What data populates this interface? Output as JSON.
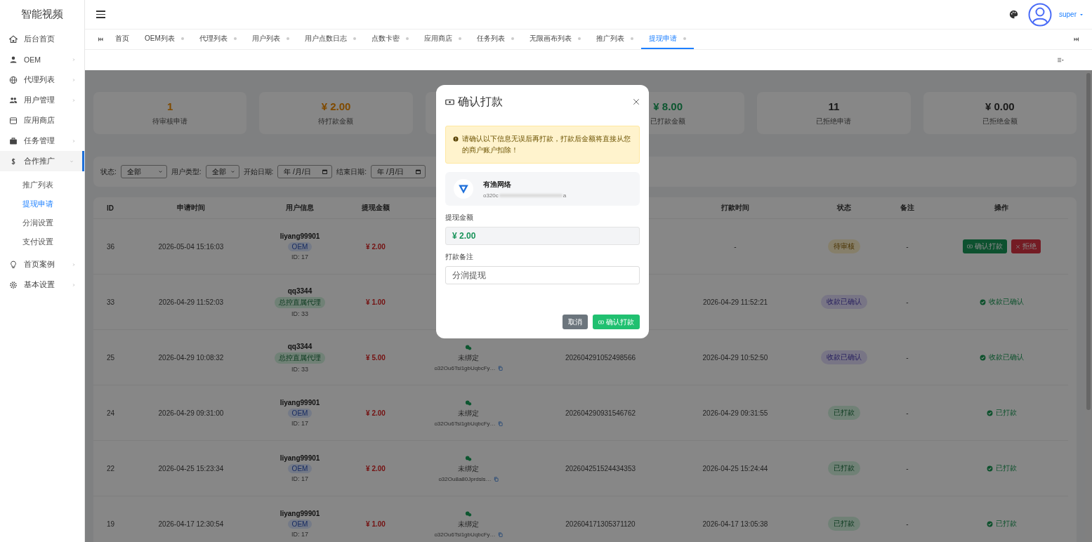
{
  "brand": "智能视频",
  "header": {
    "user": "super"
  },
  "sidebar": {
    "items": [
      {
        "label": "后台首页",
        "expandable": false,
        "expanded": false
      },
      {
        "label": "OEM",
        "expandable": true,
        "expanded": false
      },
      {
        "label": "代理列表",
        "expandable": true,
        "expanded": false
      },
      {
        "label": "用户管理",
        "expandable": true,
        "expanded": false
      },
      {
        "label": "应用商店",
        "expandable": false,
        "expanded": false
      },
      {
        "label": "任务管理",
        "expandable": true,
        "expanded": false
      },
      {
        "label": "合作推广",
        "expandable": true,
        "expanded": true,
        "children": [
          {
            "label": "推广列表",
            "selected": false
          },
          {
            "label": "提现申请",
            "selected": true
          },
          {
            "label": "分润设置",
            "selected": false
          },
          {
            "label": "支付设置",
            "selected": false
          }
        ]
      },
      {
        "label": "首页案例",
        "expandable": true,
        "expanded": false
      },
      {
        "label": "基本设置",
        "expandable": true,
        "expanded": false
      }
    ]
  },
  "tabs": [
    {
      "label": "首页",
      "closable": false,
      "selected": false
    },
    {
      "label": "OEM列表",
      "closable": true,
      "selected": false
    },
    {
      "label": "代理列表",
      "closable": true,
      "selected": false
    },
    {
      "label": "用户列表",
      "closable": true,
      "selected": false
    },
    {
      "label": "用户点数日志",
      "closable": true,
      "selected": false
    },
    {
      "label": "点数卡密",
      "closable": true,
      "selected": false
    },
    {
      "label": "应用商店",
      "closable": true,
      "selected": false
    },
    {
      "label": "任务列表",
      "closable": true,
      "selected": false
    },
    {
      "label": "无限画布列表",
      "closable": true,
      "selected": false
    },
    {
      "label": "推广列表",
      "closable": true,
      "selected": false
    },
    {
      "label": "提现申请",
      "closable": true,
      "selected": true
    }
  ],
  "stats": [
    {
      "kind": "warning",
      "value": "1",
      "label": "待审核申请"
    },
    {
      "kind": "warning",
      "value": "¥ 2.00",
      "label": "待打款金额"
    },
    {
      "kind": "covered"
    },
    {
      "kind": "success",
      "value": "¥ 8.00",
      "label": "已打款金额"
    },
    {
      "kind": "neutral",
      "value": "11",
      "label": "已拒绝申请"
    },
    {
      "kind": "neutral",
      "value": "¥ 0.00",
      "label": "已拒绝金额"
    }
  ],
  "filters": [
    {
      "label": "状态:",
      "kind": "select",
      "value": "全部"
    },
    {
      "label": "用户类型:",
      "kind": "select",
      "value": "全部"
    },
    {
      "label": "开始日期:",
      "kind": "date",
      "value": "年 /月/日"
    },
    {
      "label": "结束日期:",
      "kind": "date",
      "value": "年 /月/日"
    }
  ],
  "table": {
    "columns": [
      {
        "label": "ID"
      },
      {
        "label": "申请时间"
      },
      {
        "label": "用户信息"
      },
      {
        "label": "提现金额"
      },
      {},
      {},
      {
        "label": "打款时间"
      },
      {
        "label": "状态"
      },
      {
        "label": "备注"
      },
      {
        "label": "操作"
      }
    ],
    "rows": [
      {
        "id": "36",
        "apply_time": "2026-05-04 15:16:03",
        "user": {
          "name": "liyang99901",
          "type": "OEM",
          "kind": "oem",
          "uid": "ID: 17"
        },
        "amount": "¥ 2.00",
        "pay_time": "-",
        "status": {
          "text": "待审核",
          "kind": "pending"
        },
        "remark": "-",
        "action": {
          "kind": "buttons",
          "buttons": [
            {
              "label": "确认打款",
              "kind": "confirm"
            },
            {
              "label": "拒绝",
              "kind": "reject"
            }
          ]
        }
      },
      {
        "id": "33",
        "apply_time": "2026-04-29 11:52:03",
        "user": {
          "name": "qq3344",
          "type": "总控直属代理",
          "kind": "agent",
          "uid": "ID: 33"
        },
        "amount": "¥ 1.00",
        "pay_time": "2026-04-29 11:52:21",
        "status": {
          "text": "收款已确认",
          "kind": "received"
        },
        "remark": "-",
        "action": {
          "kind": "done",
          "label": "收款已确认"
        }
      },
      {
        "id": "25",
        "apply_time": "2026-04-29 10:08:32",
        "user": {
          "name": "qq3344",
          "type": "总控直属代理",
          "kind": "agent",
          "uid": "ID: 33"
        },
        "amount": "¥ 5.00",
        "account": {
          "status": "未绑定",
          "text": "o32Ou6Tsi1gbUqbcFy…"
        },
        "order_no": "202604291052498566",
        "pay_time": "2026-04-29 10:52:50",
        "status": {
          "text": "收款已确认",
          "kind": "received"
        },
        "remark": "-",
        "action": {
          "kind": "done",
          "label": "收款已确认"
        }
      },
      {
        "id": "24",
        "apply_time": "2026-04-29 09:31:00",
        "user": {
          "name": "liyang99901",
          "type": "OEM",
          "kind": "oem",
          "uid": "ID: 17"
        },
        "amount": "¥ 2.00",
        "account": {
          "status": "未绑定",
          "text": "o32Ou6Tsi1gbUqbcFy…"
        },
        "order_no": "202604290931546762",
        "pay_time": "2026-04-29 09:31:55",
        "status": {
          "text": "已打款",
          "kind": "paid"
        },
        "remark": "-",
        "action": {
          "kind": "done",
          "label": "已打款"
        }
      },
      {
        "id": "22",
        "apply_time": "2026-04-25 15:23:34",
        "user": {
          "name": "liyang99901",
          "type": "OEM",
          "kind": "oem",
          "uid": "ID: 17"
        },
        "amount": "¥ 2.00",
        "account": {
          "status": "未绑定",
          "text": "o32Ou8a80Jprdsls…"
        },
        "order_no": "202604251524434353",
        "pay_time": "2026-04-25 15:24:44",
        "status": {
          "text": "已打款",
          "kind": "paid"
        },
        "remark": "-",
        "action": {
          "kind": "done",
          "label": "已打款"
        }
      },
      {
        "id": "19",
        "apply_time": "2026-04-17 12:30:54",
        "user": {
          "name": "liyang99901",
          "type": "OEM",
          "kind": "oem",
          "uid": "ID: 17"
        },
        "amount": "¥ 1.00",
        "account": {
          "status": "未绑定",
          "text": "o32Ou6Tsi1gbUqbcFy…"
        },
        "order_no": "202604171305371120",
        "pay_time": "2026-04-17 13:05:38",
        "status": {
          "text": "已打款",
          "kind": "paid"
        },
        "remark": "-",
        "action": {
          "kind": "done",
          "label": "已打款"
        }
      }
    ]
  },
  "modal": {
    "title": "确认打款",
    "alert": "请确认以下信息无误后再打款，打款后金额将直接从您的商户账户扣除！",
    "merchant": {
      "name": "有渔网络",
      "account_start": "o320c",
      "account_end": "a"
    },
    "amount_label": "提现金额",
    "amount": "¥ 2.00",
    "remark_label": "打款备注",
    "remark": "分润提现",
    "buttons": [
      {
        "label": "取消",
        "kind": "cancel"
      },
      {
        "label": "确认打款",
        "kind": "confirm"
      }
    ]
  }
}
